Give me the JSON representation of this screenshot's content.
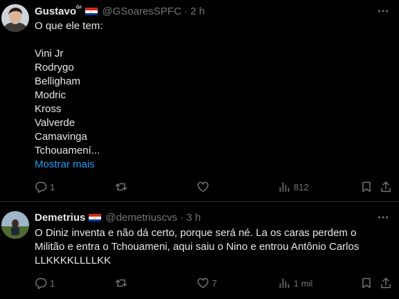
{
  "tweets": [
    {
      "name": "Gustavo",
      "name_sup": "ᴳ¹",
      "handle": "@GSoaresSPFC",
      "dot": "·",
      "time": "2 h",
      "flag": "paraguay",
      "lines": [
        "O que ele tem:",
        "",
        "Vini Jr",
        "Rodrygo",
        "Belligham",
        "Modric",
        "Kross",
        "Valverde",
        "Camavinga",
        "Tchouamení..."
      ],
      "show_more": "Mostrar mais",
      "replies": "1",
      "retweets": "",
      "likes": "",
      "views": "812"
    },
    {
      "name": "Demetrius",
      "handle": "@demetriuscvs",
      "dot": "·",
      "time": "3 h",
      "flag": "paraguay",
      "lines": [
        "O Diniz inventa e não dá certo, porque será né. La os caras perdem o",
        "Militão e entra o Tchouameni, aqui saiu o Nino e entrou Antônio Carlos",
        "LLKKKKLLLLKK"
      ],
      "replies": "1",
      "retweets": "",
      "likes": "7",
      "views": "1 mil"
    }
  ],
  "colors": {
    "text": "#e7e9ea",
    "muted": "#71767b",
    "link": "#1d9bf0",
    "border": "#2f3336",
    "background": "#000000"
  },
  "icons": [
    "reply-icon",
    "retweet-icon",
    "like-icon",
    "views-icon",
    "bookmark-icon",
    "share-icon",
    "more-icon"
  ]
}
